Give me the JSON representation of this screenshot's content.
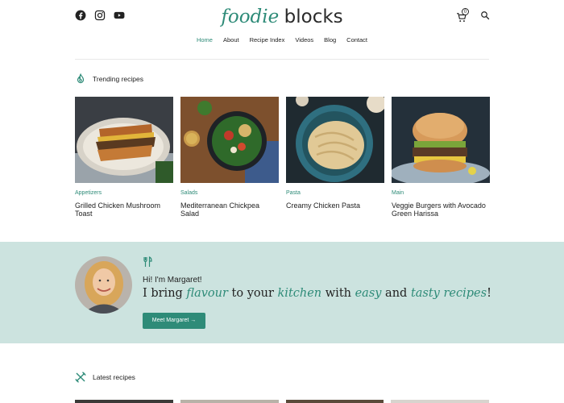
{
  "header": {
    "logo_part1": "foodie",
    "logo_part2": "blocks",
    "cart_count": "0",
    "social_icons": [
      "facebook-icon",
      "instagram-icon",
      "youtube-icon"
    ]
  },
  "nav": {
    "items": [
      "Home",
      "About",
      "Recipe Index",
      "Videos",
      "Blog",
      "Contact"
    ],
    "active": "Home"
  },
  "trending": {
    "heading": "Trending recipes",
    "cards": [
      {
        "category": "Appetizers",
        "title": "Grilled Chicken Mushroom Toast"
      },
      {
        "category": "Salads",
        "title": "Mediterranean Chickpea Salad"
      },
      {
        "category": "Pasta",
        "title": "Creamy Chicken Pasta"
      },
      {
        "category": "Main",
        "title": "Veggie Burgers with Avocado Green Harissa"
      }
    ]
  },
  "about": {
    "greeting": "Hi! I'm Margaret!",
    "tagline_parts": [
      "I bring ",
      "flavour",
      " to your ",
      "kitchen",
      " with ",
      "easy",
      " and ",
      "tasty recipes",
      "!"
    ],
    "button": "Meet Margaret →"
  },
  "latest": {
    "heading": "Latest recipes"
  },
  "colors": {
    "accent": "#2e8b78",
    "band": "#cce3df"
  }
}
